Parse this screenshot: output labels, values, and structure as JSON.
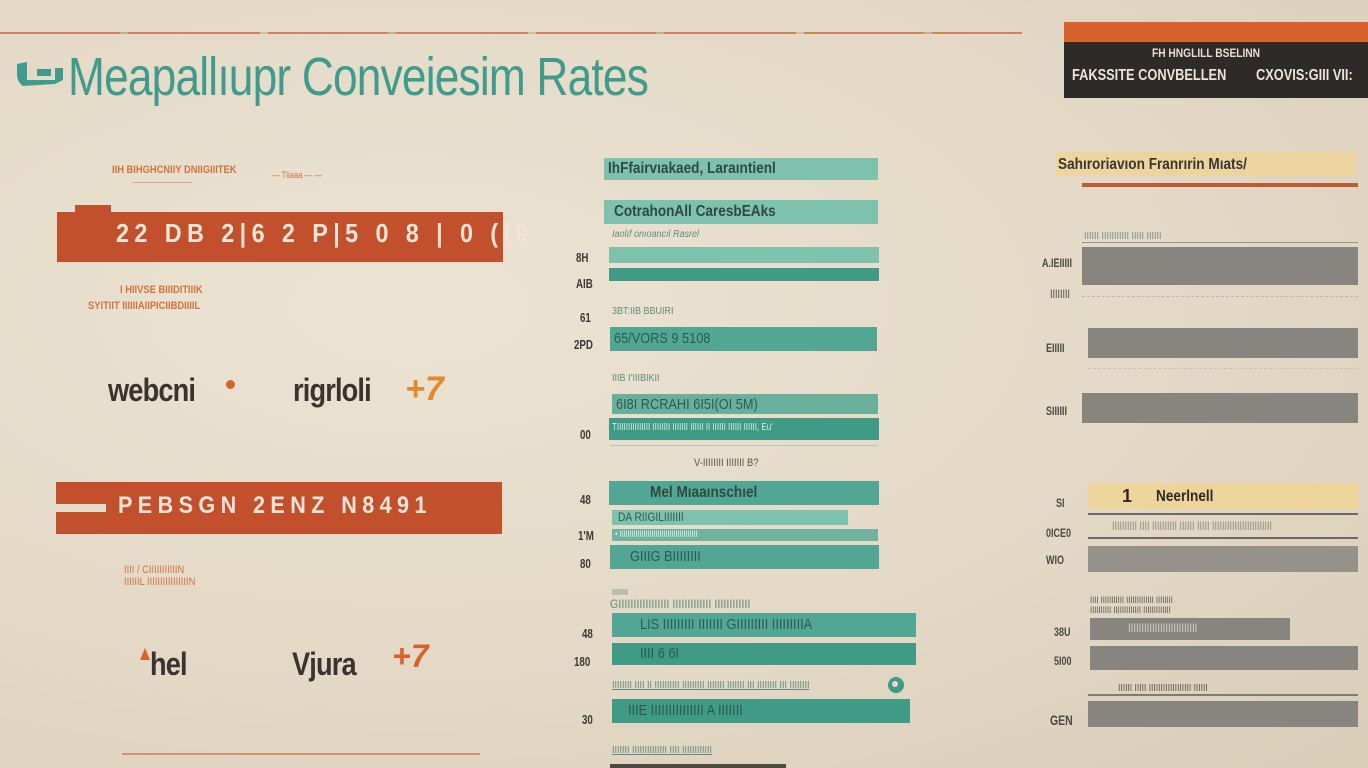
{
  "header": {
    "title": "Meapallıupr  Conveiesim Rates",
    "icon": "tape-dispenser-icon"
  },
  "banner": {
    "subtitle": "FH HNGLILL BSELINN",
    "label_left": "FAKSSITE CONVBELLEN",
    "label_right": "CXOVIS:GIII VII:"
  },
  "left": {
    "caption_top": "IIH BIHGHCNIIY DNIIGIIITEK",
    "caption_top_trail": "— Tliaaa — —",
    "bar1_text": "22 DB 2|6 2 P|5 0 8 | 0 (i9",
    "caption_mid_1": "I HIIVSE BIIIDITIIIK",
    "caption_mid_2": "SYITIIT IIIIIIAIIPICIIBDIIIIL",
    "logo1": "webcni",
    "logo2": "rigrloli",
    "logo2_mark": "+7",
    "bar2_text": "PEBSGN 2ENZ N8491",
    "caption_bottom_1": "IIII / CIIIIIIIIIIIN",
    "caption_bottom_2": "IIIIIIL IIIIIIIIIIIIIIIIN",
    "logo3": "hel",
    "logo4": "Vjura",
    "logo4_mark": "+7"
  },
  "middle": {
    "header1": "IhFfairvıakaed,  Laraıntienl",
    "header2": "CotrahonAll  CaresbEAks",
    "caption1": "Iaolıf onıoancıl Rasrel",
    "rows_a": [
      {
        "label": "8H",
        "value_fraction": 1.0
      },
      {
        "label": "AIB",
        "value_fraction": 1.0
      }
    ],
    "caption2": "3BT:IIB BBUIRI",
    "rows_b": [
      {
        "label": "61",
        "text": ""
      },
      {
        "label": "2PD",
        "text": "65/VORS 9 5108"
      }
    ],
    "caption3": "IIIB I’IIIBIKII",
    "bar_b2_text": "6I8I RCRAHI 6I5I(OI 5M)",
    "bar_b3_text": "TIIIIIIIIIIIIIII IIIIIIII IIIIIII IIIIII II IIIIII IIIIII IIIIII, Eu'",
    "label_00": "00",
    "caption4": "V-IIIIIIII IIIIIII B?",
    "rows_c": [
      {
        "label": "48",
        "text": "Mel Mıaaınschıel"
      },
      {
        "label": "",
        "text": "DA RIIGILIIIIIII"
      },
      {
        "label": "1'M",
        "text": "• IIIIIIIIIIIIIIIIIIIIIIIIIIIIIIIIIIIIIII"
      },
      {
        "label": "80",
        "text": "GIIIG BIIIIIIII"
      }
    ],
    "caption5_top": "IIIIIIII",
    "caption5": "GIIIIIIIIIIIIIIIII IIIIIIIIIIIII IIIIIIIIIIII",
    "rows_d": [
      {
        "label": "48",
        "text": "LIS IIIIIIIII IIIIIII GIIIIIIIII IIIIIIIIIA"
      },
      {
        "label": "180",
        "text": "IIII 6 6I"
      }
    ],
    "caption6": "IIIIIIII IIII II IIIIIIIIII IIIIIIIII IIIIIII IIIIIII III IIIIIIII III IIIIIIII",
    "rows_e": [
      {
        "label": "30",
        "text": "IIIE IIIIIIIIIIIIIII A IIIIIII"
      }
    ],
    "caption7": "IIIIIII IIIIIIIIIIIIII IIII IIIIIIIIIIII"
  },
  "right": {
    "header": "Sahıroriavıon Franrırin Mıats/",
    "caption1": "IIIIII IIIIIIIIIII IIIII IIIIII",
    "rows_a": [
      {
        "label": "A.IEIIIII",
        "sublabel": "IIIIIIII"
      },
      {
        "label": "EIIIII"
      },
      {
        "label": "SIIIIII"
      }
    ],
    "rows_b": [
      {
        "label": "SI",
        "rank": "1",
        "text": "Neerlnell"
      },
      {
        "label": "0ICE0",
        "text": "IIIIIIIIII IIII IIIIIIIIII IIIIII IIIII IIIIIIIIIIIIIIIIIIIIIIII"
      },
      {
        "label": "WIO",
        "text": ""
      }
    ],
    "caption2_1": "IIII IIIIIIIIIII IIIIIIIIIIIII IIIIIIII",
    "caption2_2": "IIIIIIIIII IIIIIIIIIIIII IIIIIIIIIIIII",
    "rows_c": [
      {
        "label": "38U",
        "text": "IIIIIIIIIIIIIIIIIIIIIIIIII"
      },
      {
        "label": "5I00",
        "text": ""
      }
    ],
    "caption3": "IIIIII IIIII IIIIIIIIIIIIIIIIII IIIIII",
    "rows_d": [
      {
        "label": "GEN",
        "text": ""
      }
    ]
  },
  "colors": {
    "teal": "#3f9c8c",
    "rust": "#c3502c",
    "orange": "#d9612c",
    "banner_black": "#2d2a27",
    "gray_bar": "#888581",
    "yellow": "#ecd49a"
  }
}
